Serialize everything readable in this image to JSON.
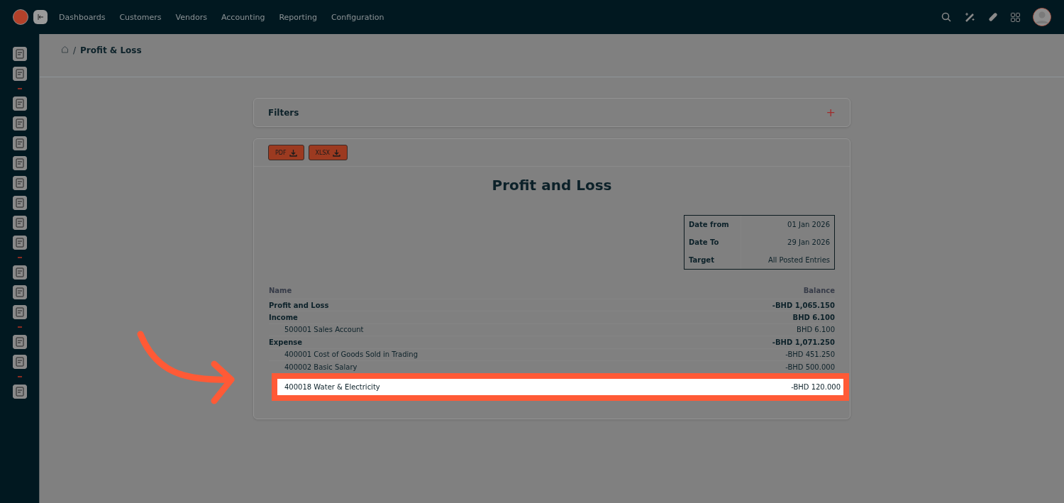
{
  "nav": {
    "items": [
      "Dashboards",
      "Customers",
      "Vendors",
      "Accounting",
      "Reporting",
      "Configuration"
    ]
  },
  "breadcrumb": {
    "separator": "/",
    "current": "Profit & Loss"
  },
  "filters": {
    "title": "Filters",
    "toggle": "+"
  },
  "exports": [
    "PDF",
    "XLSX"
  ],
  "report": {
    "title": "Profit and Loss",
    "info": [
      {
        "label": "Date from",
        "value": "01 Jan 2026"
      },
      {
        "label": "Date To",
        "value": "29 Jan 2026"
      },
      {
        "label": "Target",
        "value": "All Posted Entries"
      }
    ],
    "columns": [
      "Name",
      "Balance"
    ],
    "rows": [
      {
        "kind": "section",
        "name": "Profit and Loss",
        "balance": "-BHD 1,065.150",
        "highlighted": false
      },
      {
        "kind": "section",
        "name": "Income",
        "balance": "BHD 6.100",
        "highlighted": false
      },
      {
        "kind": "account",
        "name": "500001 Sales Account",
        "balance": "BHD 6.100",
        "highlighted": false
      },
      {
        "kind": "section",
        "name": "Expense",
        "balance": "-BHD 1,071.250",
        "highlighted": false
      },
      {
        "kind": "account",
        "name": "400001 Cost of Goods Sold in Trading",
        "balance": "-BHD 451.250",
        "highlighted": false
      },
      {
        "kind": "account",
        "name": "400002 Basic Salary",
        "balance": "-BHD 500.000",
        "highlighted": false
      },
      {
        "kind": "account",
        "name": "400018 Water & Electricity",
        "balance": "-BHD 120.000",
        "highlighted": true
      }
    ]
  }
}
